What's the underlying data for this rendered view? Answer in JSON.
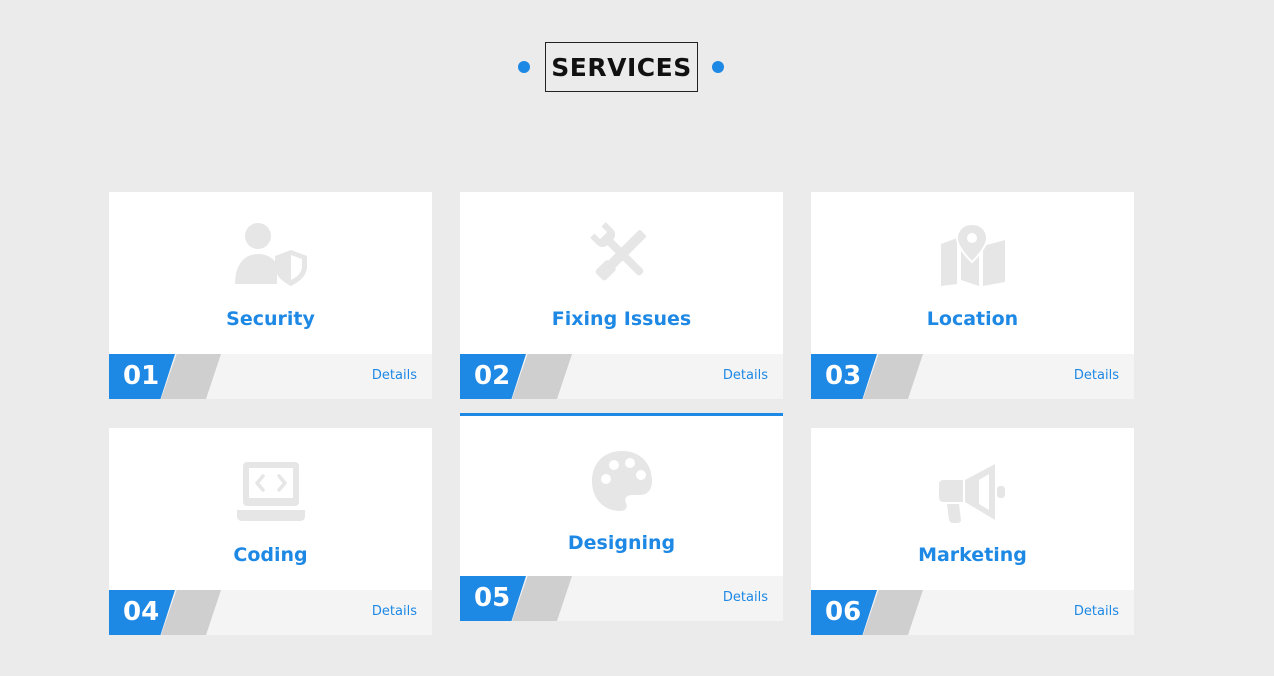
{
  "section": {
    "title": "SERVICES"
  },
  "services": [
    {
      "number": "01",
      "name": "Security",
      "details": "Details",
      "icon": "user-shield-icon"
    },
    {
      "number": "02",
      "name": "Fixing Issues",
      "details": "Details",
      "icon": "tools-icon"
    },
    {
      "number": "03",
      "name": "Location",
      "details": "Details",
      "icon": "map-location-icon"
    },
    {
      "number": "04",
      "name": "Coding",
      "details": "Details",
      "icon": "laptop-code-icon"
    },
    {
      "number": "05",
      "name": "Designing",
      "details": "Details",
      "icon": "palette-icon"
    },
    {
      "number": "06",
      "name": "Marketing",
      "details": "Details",
      "icon": "megaphone-icon"
    }
  ],
  "colors": {
    "accent": "#1e88e5",
    "background": "#ebebeb",
    "icon": "#e6e6e6",
    "footer": "#f4f4f4",
    "slant": "#cfcfcf"
  }
}
